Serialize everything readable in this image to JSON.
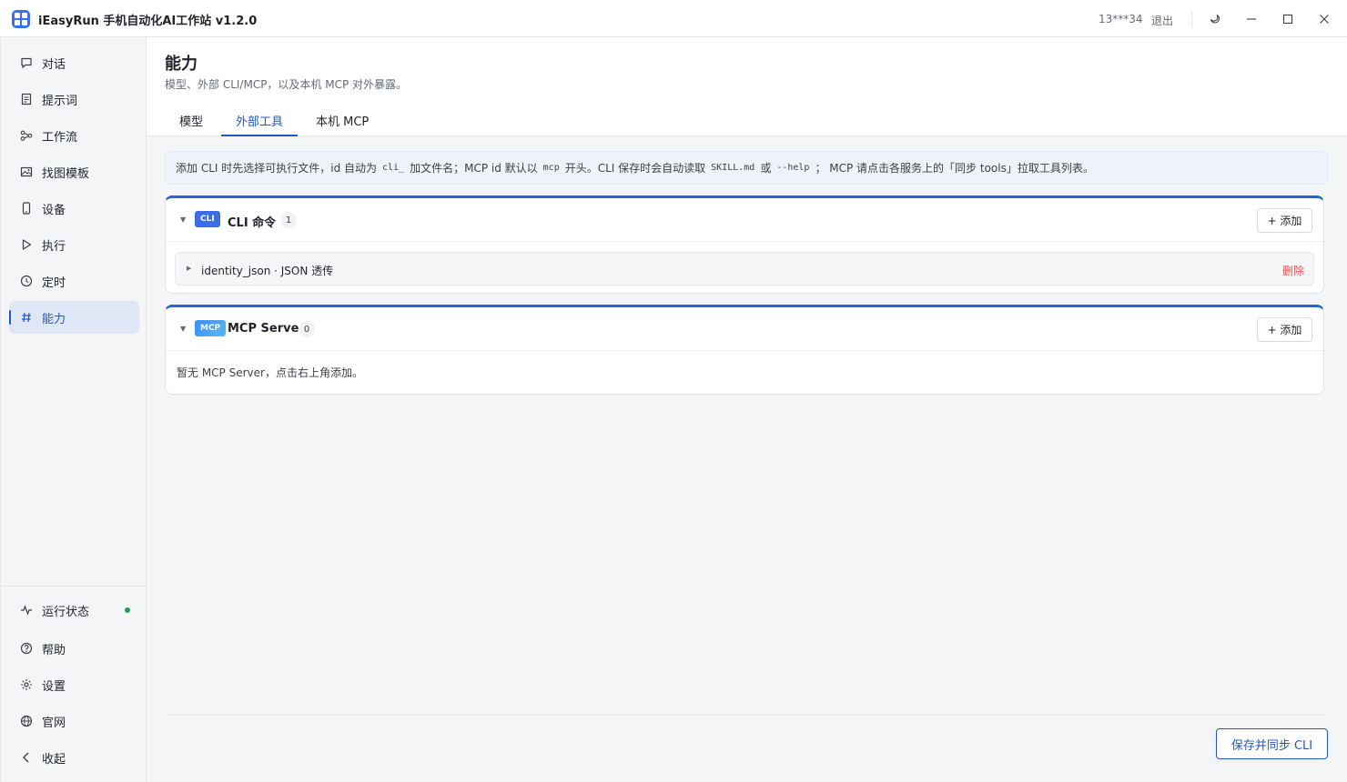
{
  "app": {
    "title": "iEasyRun 手机自动化AI工作站 v1.2.0",
    "user_id": "13***34",
    "logout_label": "退出"
  },
  "sidebar": {
    "items": [
      {
        "label": "对话",
        "icon": "chat-icon"
      },
      {
        "label": "提示词",
        "icon": "document-icon"
      },
      {
        "label": "工作流",
        "icon": "workflow-icon"
      },
      {
        "label": "找图模板",
        "icon": "image-icon"
      },
      {
        "label": "设备",
        "icon": "phone-icon"
      },
      {
        "label": "执行",
        "icon": "play-icon"
      },
      {
        "label": "定时",
        "icon": "clock-icon"
      },
      {
        "label": "能力",
        "icon": "hash-icon",
        "active": true
      }
    ],
    "bottom_items": [
      {
        "label": "运行状态",
        "icon": "pulse-icon",
        "status_color": "#1f9d55"
      },
      {
        "label": "帮助",
        "icon": "help-icon"
      },
      {
        "label": "设置",
        "icon": "gear-icon"
      },
      {
        "label": "官网",
        "icon": "globe-icon"
      },
      {
        "label": "收起",
        "icon": "chevron-left-icon"
      }
    ]
  },
  "page": {
    "title": "能力",
    "subtitle": "模型、外部 CLI/MCP，以及本机 MCP 对外暴露。",
    "tabs": [
      {
        "label": "模型"
      },
      {
        "label": "外部工具",
        "active": true
      },
      {
        "label": "本机 MCP"
      }
    ]
  },
  "notice": {
    "part1": "添加 CLI 时先选择可执行文件，id 自动为",
    "code1": "cli_",
    "part2": "加文件名；MCP id 默认以",
    "code2": "mcp",
    "part3": "开头。CLI 保存时会自动读取",
    "code3": "SKILL.md",
    "part4": "或",
    "code4": "--help",
    "part5": "； MCP 请点击各服务上的「同步 tools」拉取工具列表。"
  },
  "cli_panel": {
    "badge": "CLI",
    "title": "CLI 命令",
    "count": "1",
    "add_label": "+ 添加",
    "items": [
      {
        "name": "identity_json · JSON 透传",
        "delete_label": "删除"
      }
    ]
  },
  "mcp_panel": {
    "badge": "MCP",
    "title": "MCP Server",
    "count": "0",
    "add_label": "+ 添加",
    "empty_text": "暂无 MCP Server，点击右上角添加。"
  },
  "footer": {
    "save_label": "保存并同步 CLI"
  },
  "colors": {
    "accent": "#2455c6",
    "danger": "#e45454",
    "status_ok": "#1f9d55"
  }
}
